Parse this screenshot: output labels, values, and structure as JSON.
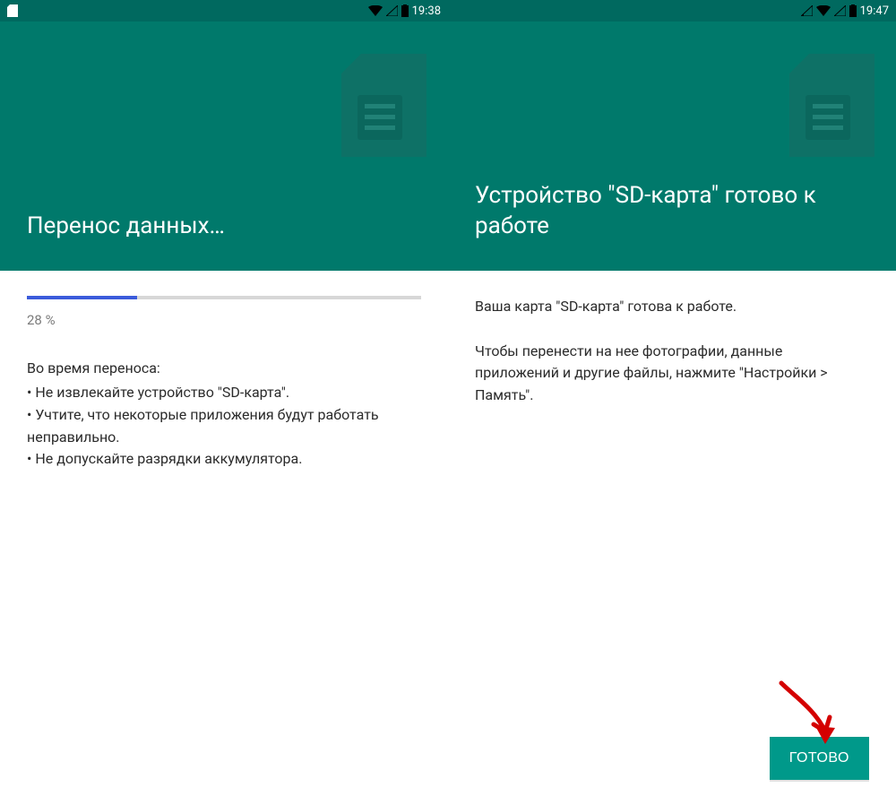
{
  "left": {
    "statusbar": {
      "time": "19:38"
    },
    "header": {
      "title": "Перенос данных…"
    },
    "progress": {
      "percent": 28,
      "percent_label": "28 %"
    },
    "body": {
      "intro": "Во время переноса:",
      "bullets": [
        "• Не извлекайте устройство \"SD-карта\".",
        "• Учтите, что некоторые приложения будут работать неправильно.",
        "• Не допускайте разрядки аккумулятора."
      ]
    }
  },
  "right": {
    "statusbar": {
      "time": "19:47"
    },
    "header": {
      "title": "Устройство \"SD-карта\" готово к работе"
    },
    "body": {
      "line1": "Ваша карта \"SD-карта\" готова к работе.",
      "line2": "Чтобы перенести на нее фотографии, данные приложений и другие файлы, нажмите \"Настройки > Память\"."
    },
    "button": {
      "label": "ГОТОВО"
    }
  },
  "colors": {
    "statusbar": "#00695f",
    "header": "#00796b",
    "button": "#00998a",
    "progress": "#3b5bdb"
  }
}
